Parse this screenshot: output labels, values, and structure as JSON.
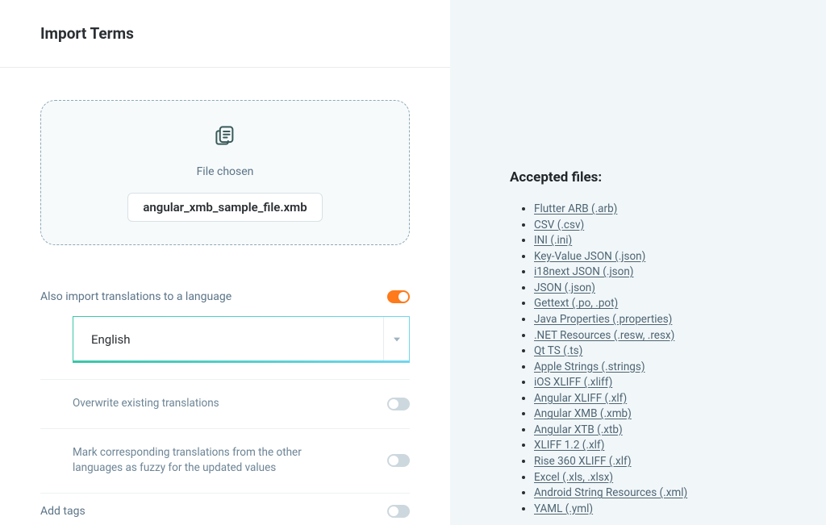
{
  "header": {
    "title": "Import Terms"
  },
  "dropzone": {
    "label": "File chosen",
    "filename": "angular_xmb_sample_file.xmb"
  },
  "options": {
    "import_translations": {
      "label": "Also import translations to a language",
      "value": true,
      "language": "English"
    },
    "overwrite": {
      "label": "Overwrite existing translations",
      "value": false
    },
    "mark_fuzzy": {
      "label": "Mark corresponding translations from the other languages as fuzzy for the updated values",
      "value": false
    },
    "add_tags": {
      "label": "Add tags",
      "value": false
    }
  },
  "accepted": {
    "heading": "Accepted files:",
    "items": [
      "Flutter ARB (.arb)",
      "CSV (.csv)",
      "INI (.ini)",
      "Key-Value JSON (.json)",
      "i18next JSON (.json)",
      "JSON (.json)",
      "Gettext (.po, .pot)",
      "Java Properties (.properties)",
      ".NET Resources (.resw, .resx)",
      "Qt TS (.ts)",
      "Apple Strings (.strings)",
      "iOS XLIFF (.xliff)",
      "Angular XLIFF (.xlf)",
      "Angular XMB (.xmb)",
      "Angular XTB (.xtb)",
      "XLIFF 1.2 (.xlf)",
      "Rise 360 XLIFF (.xlf)",
      "Excel (.xls, .xlsx)",
      "Android String Resources (.xml)",
      "YAML (.yml)"
    ]
  }
}
